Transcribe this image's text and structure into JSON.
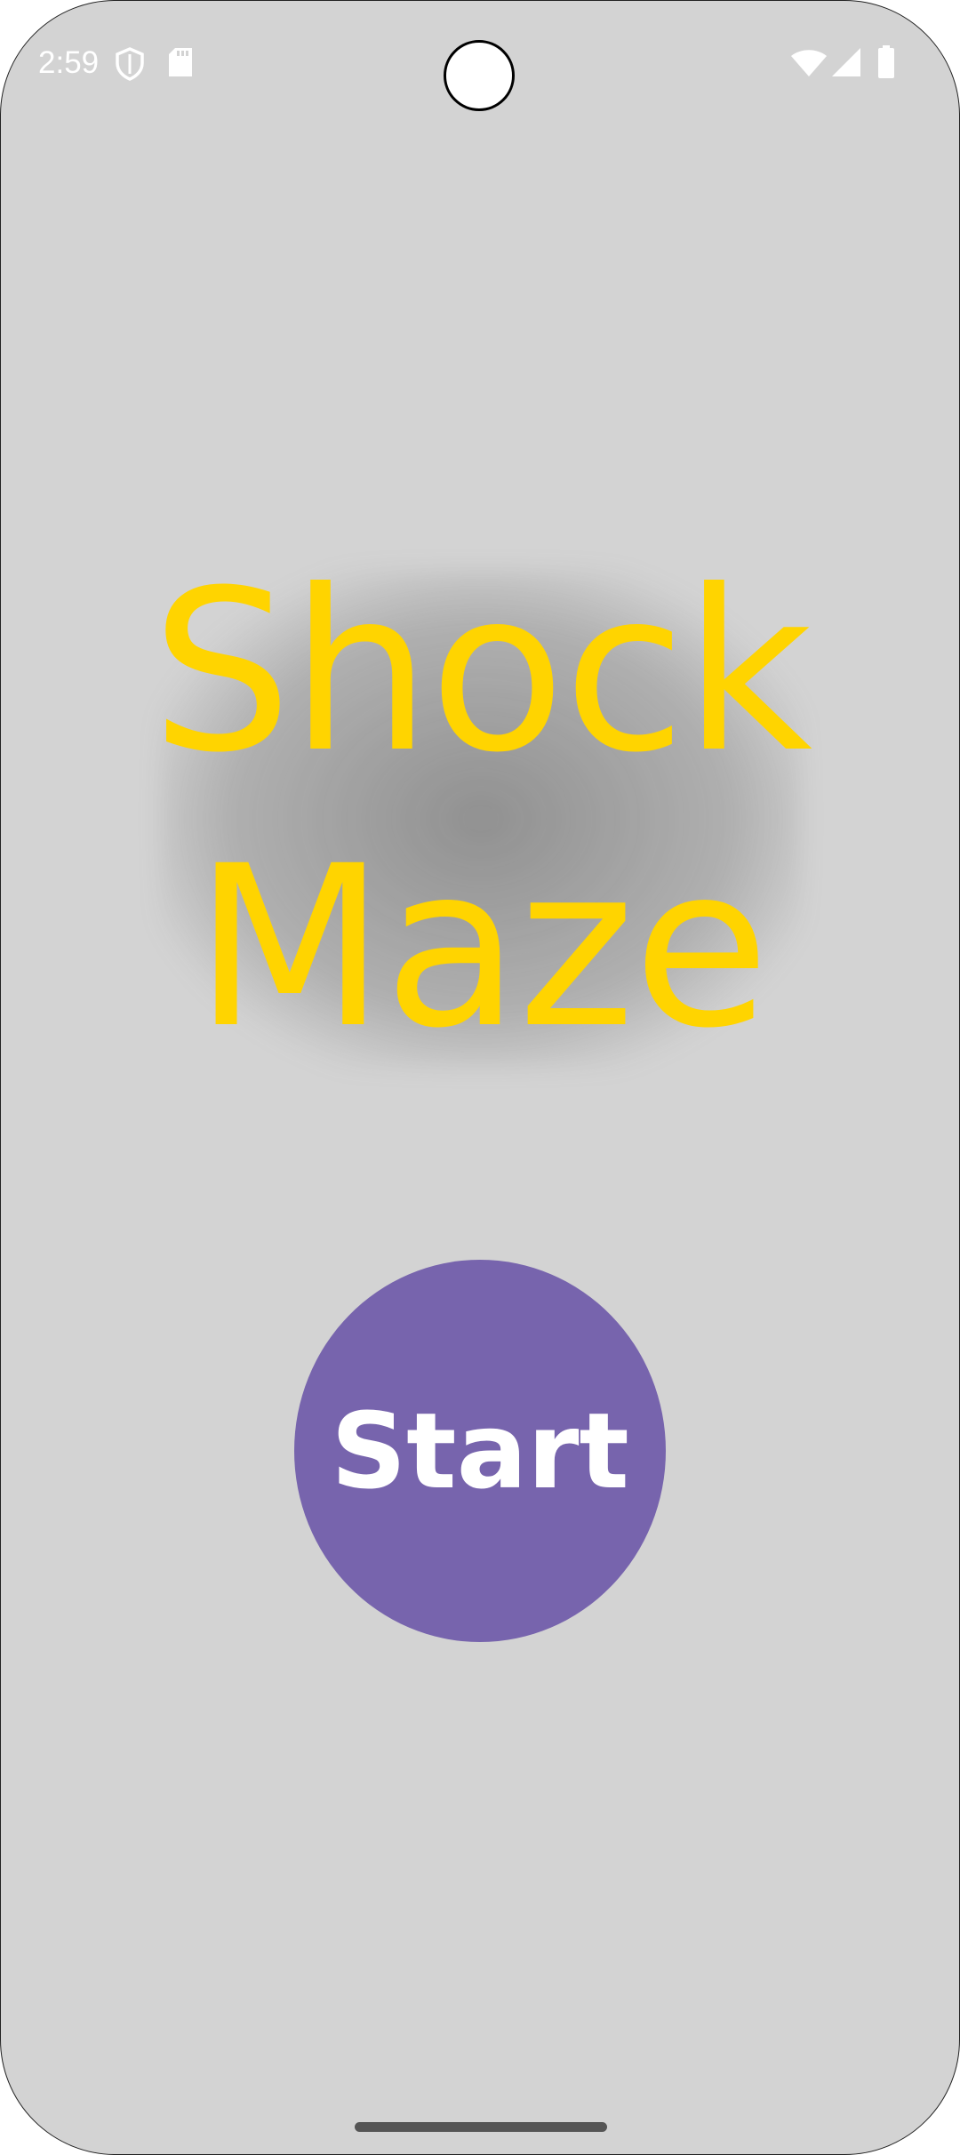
{
  "status_bar": {
    "time": "2:59",
    "left_icons": [
      "shield-icon",
      "sd-card-icon"
    ],
    "right_icons": [
      "wifi-icon",
      "signal-icon",
      "battery-icon"
    ]
  },
  "screen": {
    "title_line1": "Shock",
    "title_line2": "Maze",
    "start_label": "Start"
  },
  "colors": {
    "background": "#d3d3d3",
    "title": "#ffd400",
    "start_button": "#7764ad"
  }
}
